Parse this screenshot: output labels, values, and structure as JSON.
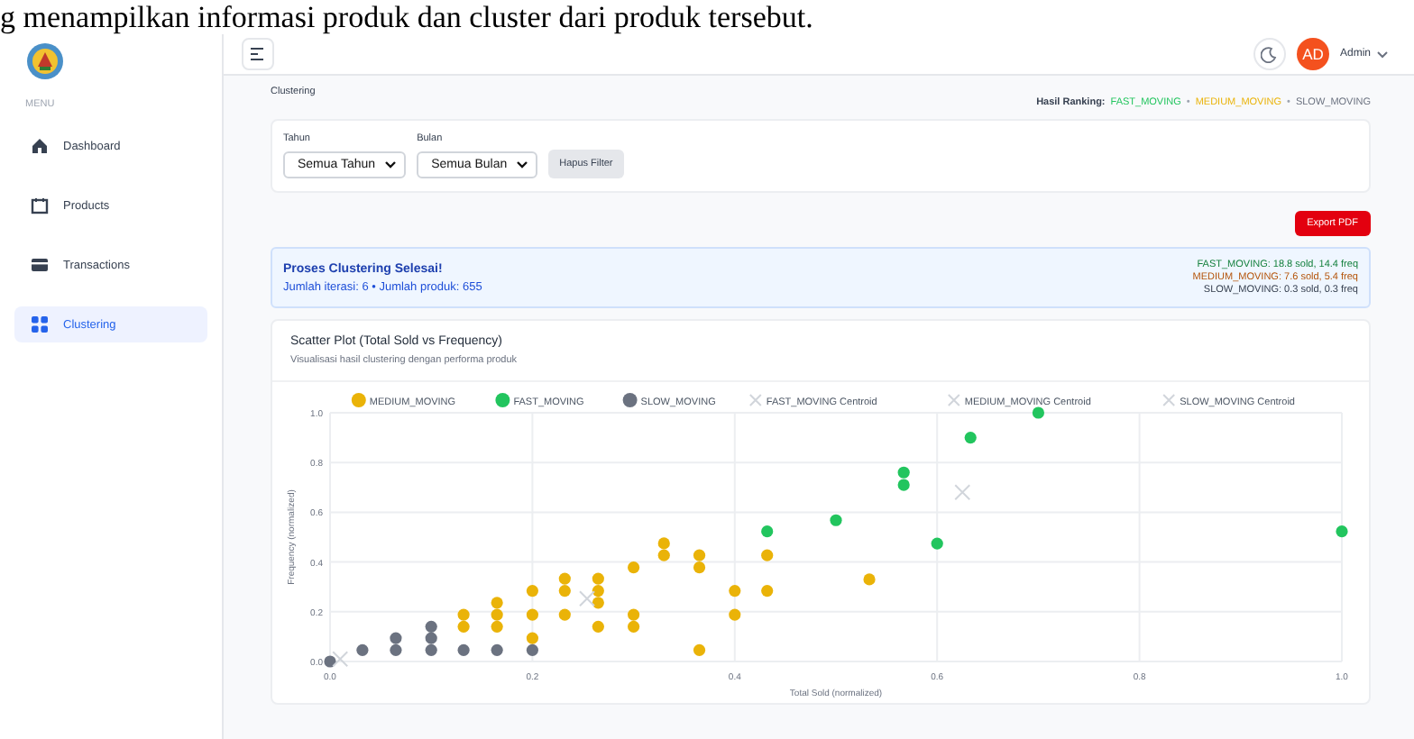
{
  "caption": "g menampilkan informasi produk dan cluster dari produk tersebut.",
  "sidebar": {
    "menu_label": "MENU",
    "items": [
      {
        "kind": "home",
        "label": "Dashboard",
        "selected": false
      },
      {
        "kind": "box",
        "label": "Products",
        "selected": false
      },
      {
        "kind": "card",
        "label": "Transactions",
        "selected": false
      },
      {
        "kind": "grid",
        "label": "Clustering",
        "selected": true
      }
    ]
  },
  "header": {
    "avatar_initials": "AD",
    "user": "Admin"
  },
  "breadcrumb": "Clustering",
  "ranking": {
    "label": "Hasil Ranking:",
    "items": [
      {
        "text": "FAST_MOVING",
        "color": "#22c55e"
      },
      {
        "text": "•",
        "color": "#9ca3af"
      },
      {
        "text": "MEDIUM_MOVING",
        "color": "#eab308"
      },
      {
        "text": "•",
        "color": "#9ca3af"
      },
      {
        "text": "SLOW_MOVING",
        "color": "#6b7280"
      }
    ]
  },
  "filters": [
    {
      "label": "Tahun",
      "value": "Semua Tahun"
    },
    {
      "label": "Bulan",
      "value": "Semua Bulan"
    }
  ],
  "clear_filter_button": "Hapus Filter",
  "export_button": "Export PDF",
  "result": {
    "title": "Proses Clustering Selesai!",
    "summary": "Jumlah iterasi: 6 • Jumlah produk: 655",
    "stats": [
      {
        "text": "FAST_MOVING: 18.8 sold, 14.4 freq",
        "color": "#15803d"
      },
      {
        "text": "MEDIUM_MOVING: 7.6 sold, 5.4 freq",
        "color": "#b45309"
      },
      {
        "text": "SLOW_MOVING: 0.3 sold, 0.3 freq",
        "color": "#374151"
      }
    ]
  },
  "chart_card": {
    "title": "Scatter Plot (Total Sold vs Frequency)",
    "subtitle": "Visualisasi hasil clustering dengan performa produk",
    "chart_data": {
      "type": "scatter",
      "xlabel": "Total Sold (normalized)",
      "ylabel": "Frequency (normalized)",
      "xlim": [
        0,
        1
      ],
      "ylim": [
        0,
        1
      ],
      "grid": true,
      "legend": "top",
      "xticks": [
        {
          "value": 0,
          "label": "0.0"
        },
        {
          "value": 0.2,
          "label": "0.2"
        },
        {
          "value": 0.4,
          "label": "0.4"
        },
        {
          "value": 0.6,
          "label": "0.6"
        },
        {
          "value": 0.8,
          "label": "0.8"
        },
        {
          "value": 1,
          "label": "1.0"
        }
      ],
      "yticks": [
        {
          "value": 0,
          "label": "0.0"
        },
        {
          "value": 0.2,
          "label": "0.2"
        },
        {
          "value": 0.4,
          "label": "0.4"
        },
        {
          "value": 0.6,
          "label": "0.6"
        },
        {
          "value": 0.8,
          "label": "0.8"
        },
        {
          "value": 1,
          "label": "1.0"
        }
      ],
      "series": [
        {
          "name": "MEDIUM_MOVING",
          "color": "#eab308",
          "marker": "circle",
          "x": [
            0.132,
            0.132,
            0.165,
            0.165,
            0.165,
            0.2,
            0.2,
            0.2,
            0.232,
            0.232,
            0.232,
            0.265,
            0.265,
            0.265,
            0.265,
            0.3,
            0.3,
            0.3,
            0.33,
            0.33,
            0.365,
            0.365,
            0.365,
            0.4,
            0.4,
            0.432,
            0.432,
            0.533
          ],
          "values": [
            0.188,
            0.14,
            0.236,
            0.188,
            0.14,
            0.284,
            0.188,
            0.094,
            0.333,
            0.284,
            0.188,
            0.333,
            0.284,
            0.236,
            0.14,
            0.378,
            0.188,
            0.14,
            0.475,
            0.427,
            0.427,
            0.378,
            0.046,
            0.284,
            0.188,
            0.427,
            0.284,
            0.33
          ]
        },
        {
          "name": "FAST_MOVING",
          "color": "#22c55e",
          "marker": "circle",
          "x": [
            0.432,
            0.5,
            0.567,
            0.567,
            0.6,
            0.633,
            0.7,
            1.0
          ],
          "values": [
            0.523,
            0.568,
            0.76,
            0.71,
            0.474,
            0.9,
            1.0,
            0.523
          ]
        },
        {
          "name": "SLOW_MOVING",
          "color": "#6b7280",
          "marker": "circle",
          "x": [
            0,
            0.032,
            0.065,
            0.065,
            0.1,
            0.1,
            0.1,
            0.132,
            0.165,
            0.2
          ],
          "values": [
            0,
            0.046,
            0.094,
            0.046,
            0.14,
            0.094,
            0.046,
            0.046,
            0.046,
            0.046
          ]
        },
        {
          "name": "FAST_MOVING Centroid",
          "color": "#d1d5db",
          "marker": "x",
          "x": [
            0.625
          ],
          "values": [
            0.68
          ]
        },
        {
          "name": "MEDIUM_MOVING Centroid",
          "color": "#d1d5db",
          "marker": "x",
          "x": [
            0.254
          ],
          "values": [
            0.253
          ]
        },
        {
          "name": "SLOW_MOVING Centroid",
          "color": "#d1d5db",
          "marker": "x",
          "x": [
            0.01
          ],
          "values": [
            0.01
          ]
        }
      ]
    }
  }
}
